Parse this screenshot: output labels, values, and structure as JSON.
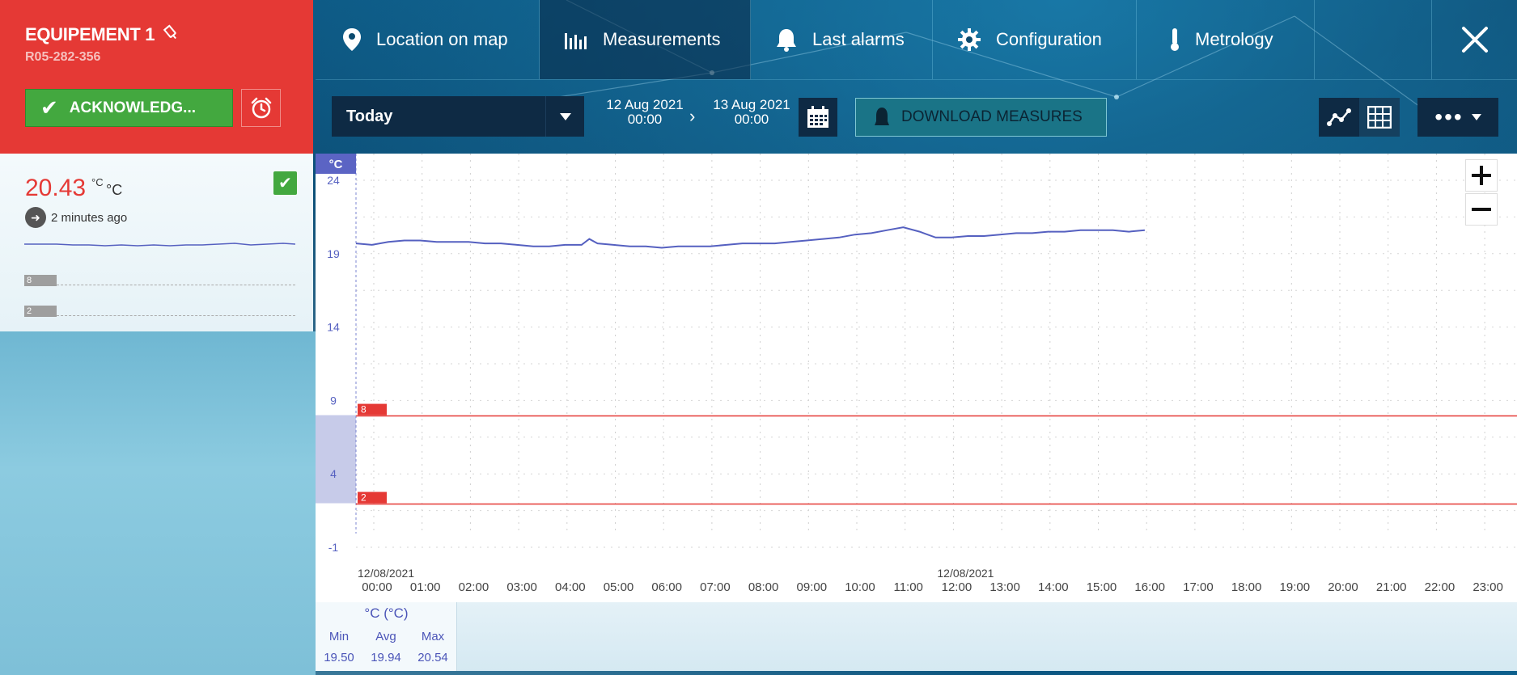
{
  "equipment": {
    "name": "EQUIPEMENT 1",
    "serial": "R05-282-356",
    "acknowledge_label": "ACKNOWLEDG...",
    "current_value": "20.43",
    "unit_sup": "°C",
    "unit": "°C",
    "last_seen": "2 minutes ago",
    "thresholds": [
      "8",
      "2"
    ]
  },
  "nav": {
    "items": [
      {
        "label": "Location on map",
        "icon": "map-pin-icon"
      },
      {
        "label": "Measurements",
        "icon": "bar-chart-icon",
        "active": true
      },
      {
        "label": "Last alarms",
        "icon": "bell-icon"
      },
      {
        "label": "Configuration",
        "icon": "gear-icon"
      },
      {
        "label": "Metrology",
        "icon": "thermometer-icon"
      }
    ]
  },
  "toolbar": {
    "period": "Today",
    "from_date": "12 Aug 2021",
    "from_time": "00:00",
    "to_date": "13 Aug 2021",
    "to_time": "00:00",
    "download_label": "DOWNLOAD MEASURES",
    "more_label": "•••"
  },
  "colors": {
    "alarm_red": "#e53935",
    "ok_green": "#43a83f",
    "series_blue": "#5560c0",
    "nav_dark": "#0e2a44"
  },
  "chart_data": {
    "type": "line",
    "ylabel": "°C",
    "ylim": [
      -1,
      24
    ],
    "yticks": [
      24,
      19,
      14,
      9,
      4,
      -1
    ],
    "x_date_labels": [
      "12/08/2021",
      "12/08/2021"
    ],
    "xticks": [
      "00:00",
      "01:00",
      "02:00",
      "03:00",
      "04:00",
      "05:00",
      "06:00",
      "07:00",
      "08:00",
      "09:00",
      "10:00",
      "11:00",
      "12:00",
      "13:00",
      "14:00",
      "15:00",
      "16:00",
      "17:00",
      "18:00",
      "19:00",
      "20:00",
      "21:00",
      "22:00",
      "23:00"
    ],
    "thresholds": [
      {
        "label": "8",
        "value": 8
      },
      {
        "label": "2",
        "value": 2
      }
    ],
    "series": [
      {
        "x": [
          0,
          0.33,
          0.67,
          1,
          1.33,
          1.67,
          2,
          2.33,
          2.67,
          3,
          3.33,
          3.67,
          4,
          4.33,
          4.67,
          4.83,
          5,
          5.33,
          5.67,
          6,
          6.33,
          6.67,
          7,
          7.33,
          7.67,
          8,
          8.33,
          8.67,
          9,
          9.33,
          9.67,
          10,
          10.33,
          10.67,
          11,
          11.33,
          11.67,
          12,
          12.33,
          12.67,
          13,
          13.33,
          13.67,
          14,
          14.33,
          14.67,
          15,
          15.33,
          15.67,
          16,
          16.33
        ],
        "y": [
          19.7,
          19.6,
          19.8,
          19.9,
          19.9,
          19.8,
          19.8,
          19.8,
          19.7,
          19.7,
          19.6,
          19.5,
          19.5,
          19.6,
          19.6,
          20.0,
          19.7,
          19.6,
          19.5,
          19.5,
          19.4,
          19.5,
          19.5,
          19.5,
          19.6,
          19.7,
          19.7,
          19.7,
          19.8,
          19.9,
          20.0,
          20.1,
          20.3,
          20.4,
          20.6,
          20.8,
          20.5,
          20.1,
          20.1,
          20.2,
          20.2,
          20.3,
          20.4,
          20.4,
          20.5,
          20.5,
          20.6,
          20.6,
          20.6,
          20.5,
          20.6
        ]
      }
    ],
    "grid": true,
    "legend": "none"
  },
  "stats": {
    "title": "°C (°C)",
    "labels": [
      "Min",
      "Avg",
      "Max"
    ],
    "values": [
      "19.50",
      "19.94",
      "20.54"
    ]
  }
}
